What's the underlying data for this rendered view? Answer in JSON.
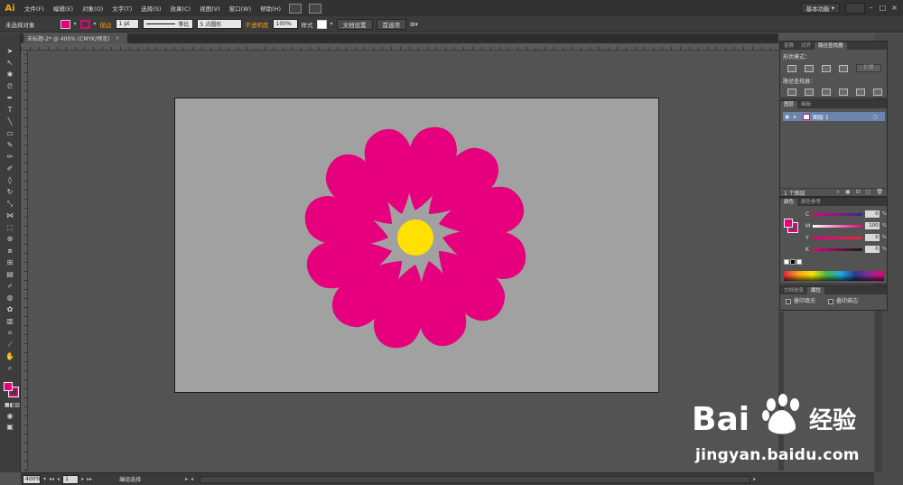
{
  "app": {
    "logo": "Ai"
  },
  "menu": [
    "文件(F)",
    "编辑(E)",
    "对象(O)",
    "文字(T)",
    "选择(S)",
    "效果(C)",
    "视图(V)",
    "窗口(W)",
    "帮助(H)"
  ],
  "workspace_label": "基本功能",
  "control_bar": {
    "selection_label": "未选择对象",
    "stroke_label": "描边",
    "stroke_value": "1 pt",
    "profile_label": "等比",
    "brush_label": "5 点圆形",
    "opacity_label": "不透明度",
    "opacity_value": "100%",
    "style_label": "样式",
    "doc_setup_button": "文档设置",
    "preferences_button": "首选项"
  },
  "document_tab": {
    "title": "未标题-2* @ 400% (CMYK/预览)",
    "close": "×"
  },
  "panels": {
    "pathfinder": {
      "tabs": [
        "变换",
        "对齐",
        "路径查找器"
      ],
      "shape_modes_label": "形状模式：",
      "pathfinders_label": "路径查找器：",
      "expand_button": "扩展"
    },
    "layers": {
      "tabs": [
        "图层",
        "画板"
      ],
      "layer_name": "图层 1",
      "footer_count": "1 个图层"
    },
    "color": {
      "tabs": [
        "颜色",
        "颜色参考"
      ],
      "channels": [
        {
          "label": "C",
          "value": "0"
        },
        {
          "label": "M",
          "value": "100"
        },
        {
          "label": "Y",
          "value": "0"
        },
        {
          "label": "K",
          "value": "0"
        }
      ],
      "unit": "%"
    },
    "attributes": {
      "tabs": [
        "文档信息",
        "属性"
      ],
      "overprint_fill": "叠印填充",
      "overprint_stroke": "叠印描边"
    }
  },
  "status_bar": {
    "zoom": "400%",
    "page": "1",
    "tool": "编组选择"
  },
  "artwork": {
    "petal_color": "#E6007E",
    "center_color": "#FFE000",
    "artboard_color": "#A0A1A0",
    "petal_count": 12
  },
  "watermark": {
    "url": "jingyan.baidu.com"
  }
}
